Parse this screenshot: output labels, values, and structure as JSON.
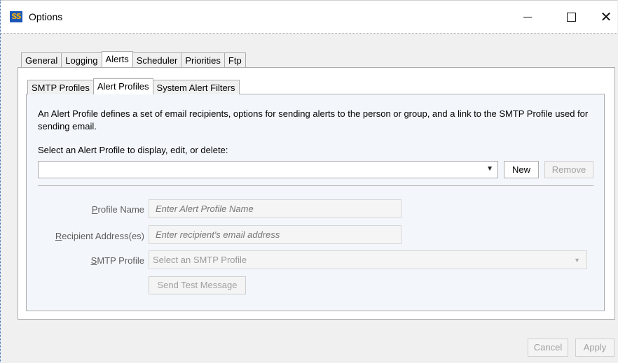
{
  "window": {
    "title": "Options",
    "icon_label": "SS"
  },
  "outer_tabs": [
    "General",
    "Logging",
    "Alerts",
    "Scheduler",
    "Priorities",
    "Ftp"
  ],
  "outer_selected": "Alerts",
  "inner_tabs": [
    "SMTP Profiles",
    "Alert Profiles",
    "System Alert Filters"
  ],
  "inner_selected": "Alert Profiles",
  "alerts": {
    "description": "An Alert Profile defines a set of email recipients, options for sending alerts to the person or group, and a link to the SMTP Profile used for sending email.",
    "select_label": "Select an Alert Profile to display, edit, or delete:",
    "combo_value": "",
    "new_label": "New",
    "remove_label": "Remove",
    "profile_name": {
      "label_underline": "P",
      "label_rest": "rofile Name",
      "placeholder": "Enter Alert Profile Name"
    },
    "recipients": {
      "label_underline": "R",
      "label_rest": "ecipient Address(es)",
      "placeholder": "Enter recipient's email address"
    },
    "smtp_profile": {
      "label_underline": "S",
      "label_rest": "MTP Profile",
      "placeholder": "Select an SMTP Profile"
    },
    "send_test_label": "Send Test Message"
  },
  "footer": {
    "cancel_label": "Cancel",
    "apply_label": "Apply"
  }
}
